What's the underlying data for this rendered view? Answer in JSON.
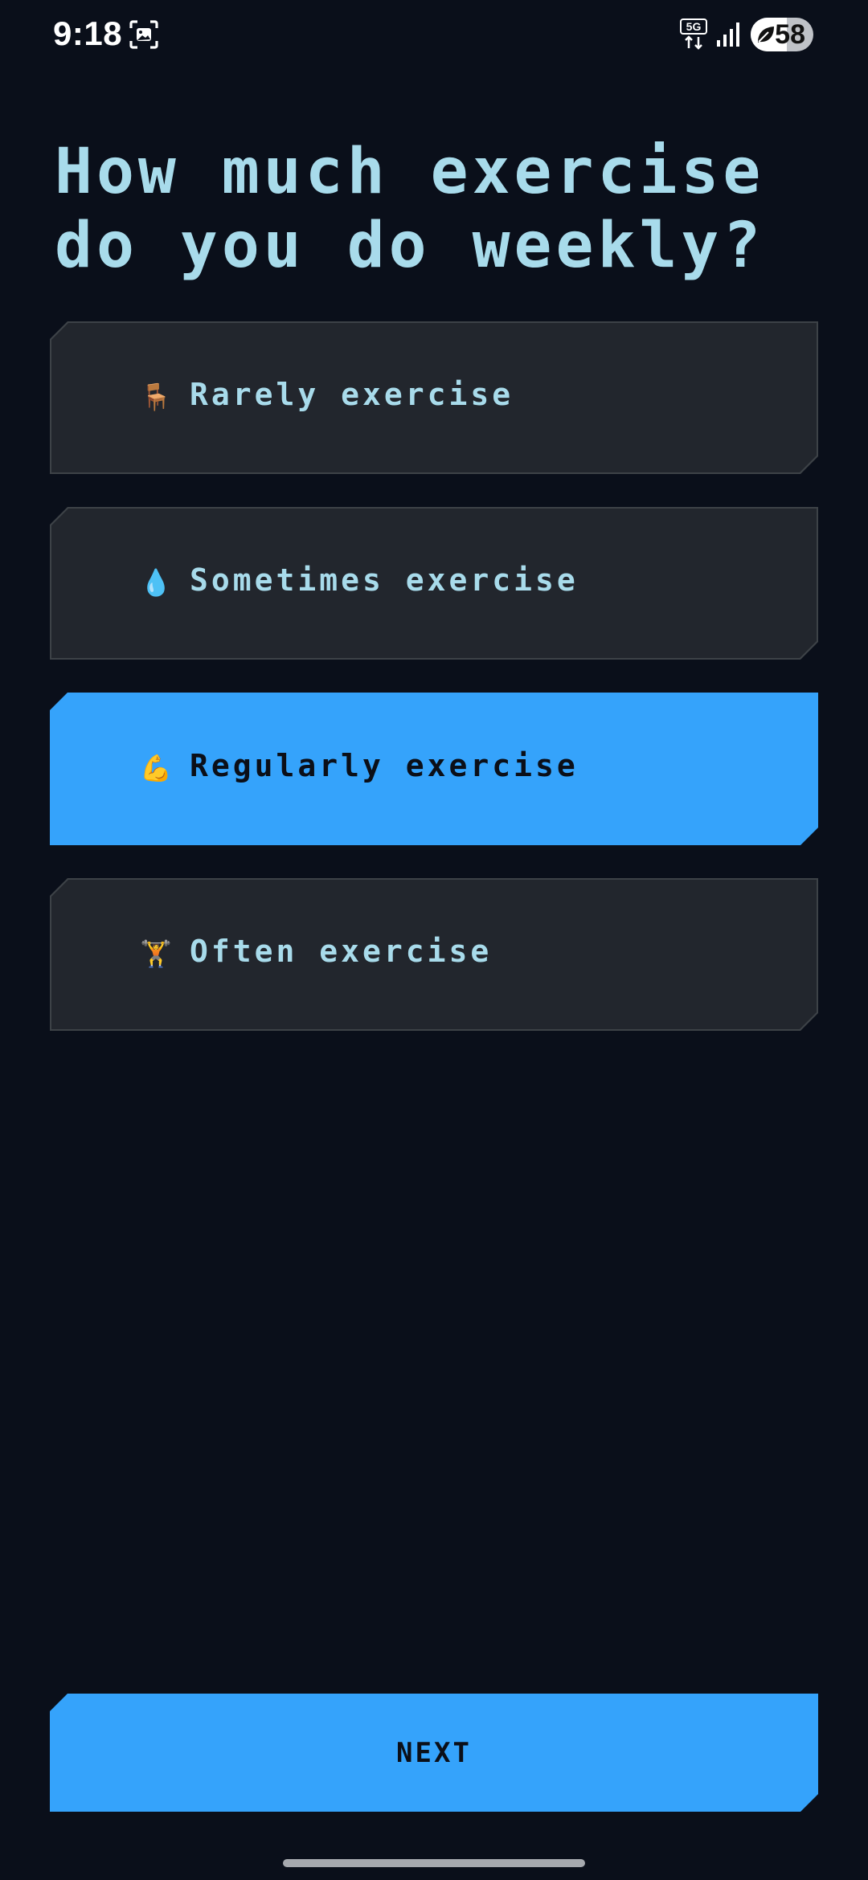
{
  "status_bar": {
    "time": "9:18",
    "network": "5G",
    "battery_percent": "58",
    "battery_level": 0.58,
    "icons": [
      "screenshot-icon",
      "network-5g-icon",
      "signal-icon",
      "battery-saver-leaf-icon"
    ]
  },
  "question": {
    "title": "How much exercise do you do weekly?"
  },
  "options": [
    {
      "emoji": "🪑",
      "icon": "chair-icon",
      "label": "Rarely exercise",
      "selected": false
    },
    {
      "emoji": "💧",
      "icon": "droplet-icon",
      "label": "Sometimes exercise",
      "selected": false
    },
    {
      "emoji": "💪",
      "icon": "flexed-biceps-icon",
      "label": "Regularly exercise",
      "selected": true
    },
    {
      "emoji": "🏋️",
      "icon": "weight-lifter-icon",
      "label": "Often exercise",
      "selected": false
    }
  ],
  "next_button": {
    "label": "NEXT"
  },
  "colors": {
    "background": "#0a0f1a",
    "accent": "#35a3fb",
    "title_text": "#a8dbeb",
    "option_bg": "#22262d",
    "option_border": "#3d4247"
  }
}
